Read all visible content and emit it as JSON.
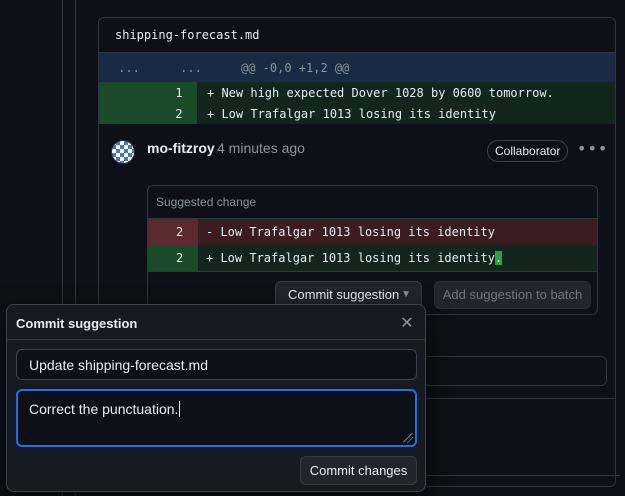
{
  "file": {
    "name": "shipping-forecast.md",
    "hunk": {
      "left_marker": "...",
      "right_marker": "...",
      "header": "@@ -0,0 +1,2 @@"
    },
    "lines": [
      {
        "num": "1",
        "code": "+ New high expected Dover 1028 by 0600 tomorrow."
      },
      {
        "num": "2",
        "code": "+ Low Trafalgar 1013 losing its identity"
      }
    ]
  },
  "comment": {
    "author": "mo-fitzroy",
    "time": "4 minutes ago",
    "badge": "Collaborator",
    "more_icon": "kebab-horizontal-icon",
    "suggestion": {
      "title": "Suggested change",
      "removed": {
        "num": "2",
        "code": "- Low Trafalgar 1013 losing its identity"
      },
      "added": {
        "num": "2",
        "code": "+ Low Trafalgar 1013 losing its identity",
        "highlight": "."
      },
      "commit_button": "Commit suggestion",
      "batch_button": "Add suggestion to batch"
    }
  },
  "dialog": {
    "title": "Commit suggestion",
    "close_icon": "x-icon",
    "message": "Update shipping-forecast.md",
    "description": "Correct the punctuation.",
    "submit": "Commit changes"
  },
  "colors": {
    "background": "#0d1117",
    "addition": "#12261e",
    "deletion": "#3a1d21",
    "focus": "#1f6feb"
  }
}
